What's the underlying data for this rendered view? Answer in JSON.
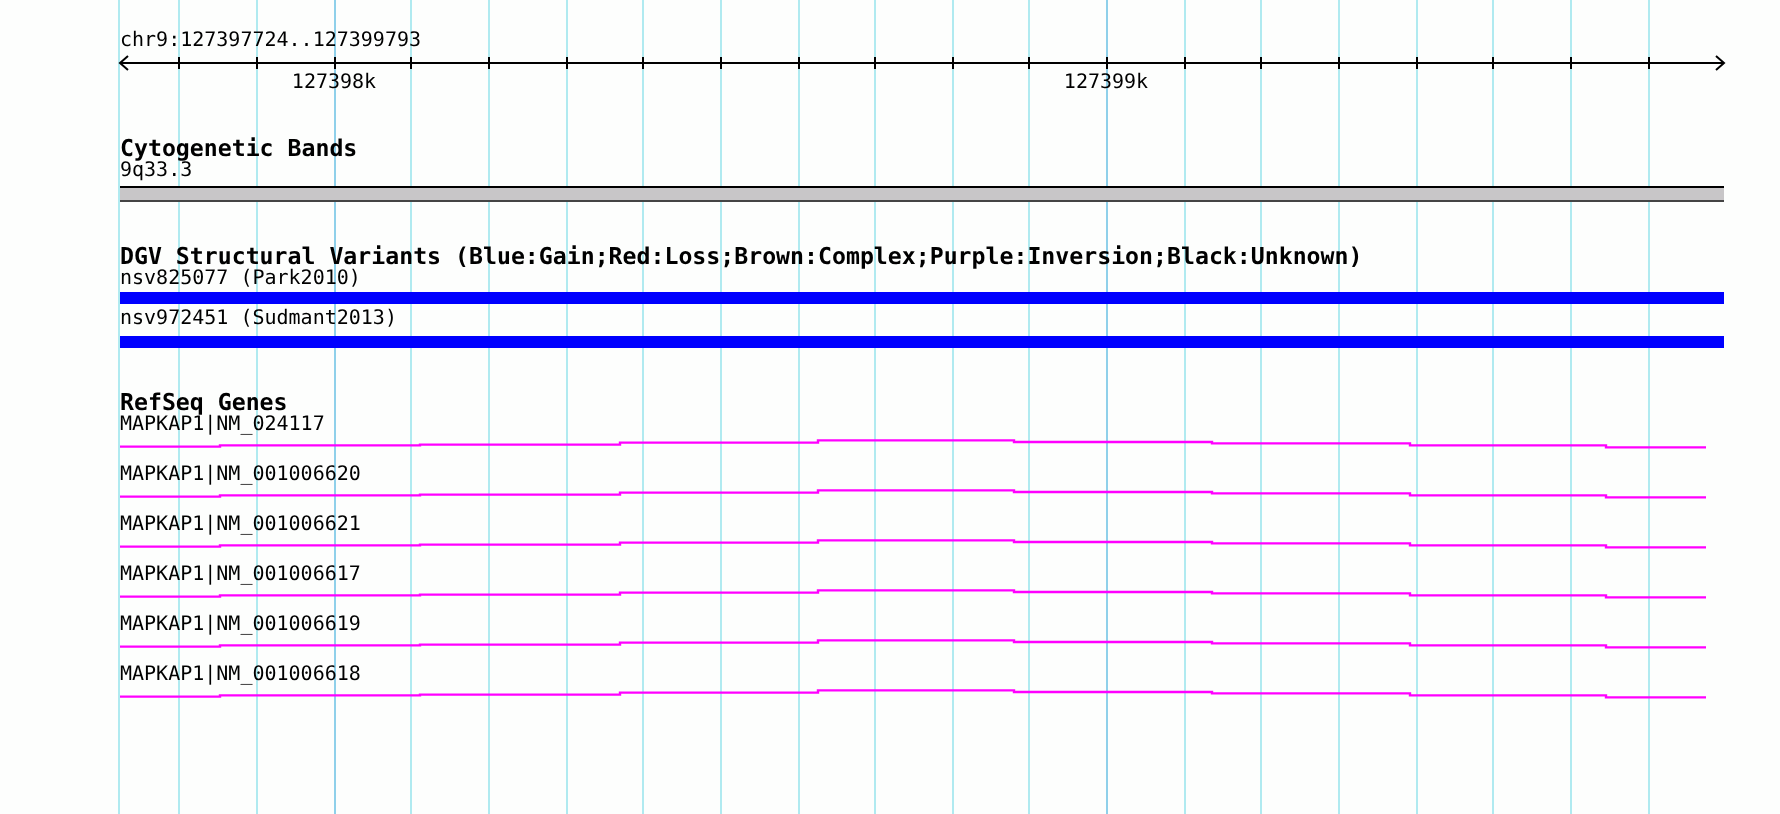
{
  "ruler": {
    "region": "chr9:127397724..127399793",
    "tick_labels": [
      "127398k",
      "127399k"
    ]
  },
  "tracks": [
    {
      "kind": "cytoband",
      "title": "Cytogenetic Bands",
      "features": [
        {
          "label": "9q33.3"
        }
      ]
    },
    {
      "kind": "variants",
      "title": "DGV Structural Variants (Blue:Gain;Red:Loss;Brown:Complex;Purple:Inversion;Black:Unknown)",
      "features": [
        {
          "label": "nsv825077 (Park2010)",
          "color": "#0000ff"
        },
        {
          "label": "nsv972451 (Sudmant2013)",
          "color": "#0000ff"
        }
      ]
    },
    {
      "kind": "genes",
      "title": "RefSeq Genes",
      "features": [
        {
          "label": "MAPKAP1|NM_024117"
        },
        {
          "label": "MAPKAP1|NM_001006620"
        },
        {
          "label": "MAPKAP1|NM_001006621"
        },
        {
          "label": "MAPKAP1|NM_001006617"
        },
        {
          "label": "MAPKAP1|NM_001006619"
        },
        {
          "label": "MAPKAP1|NM_001006618"
        }
      ]
    }
  ]
}
